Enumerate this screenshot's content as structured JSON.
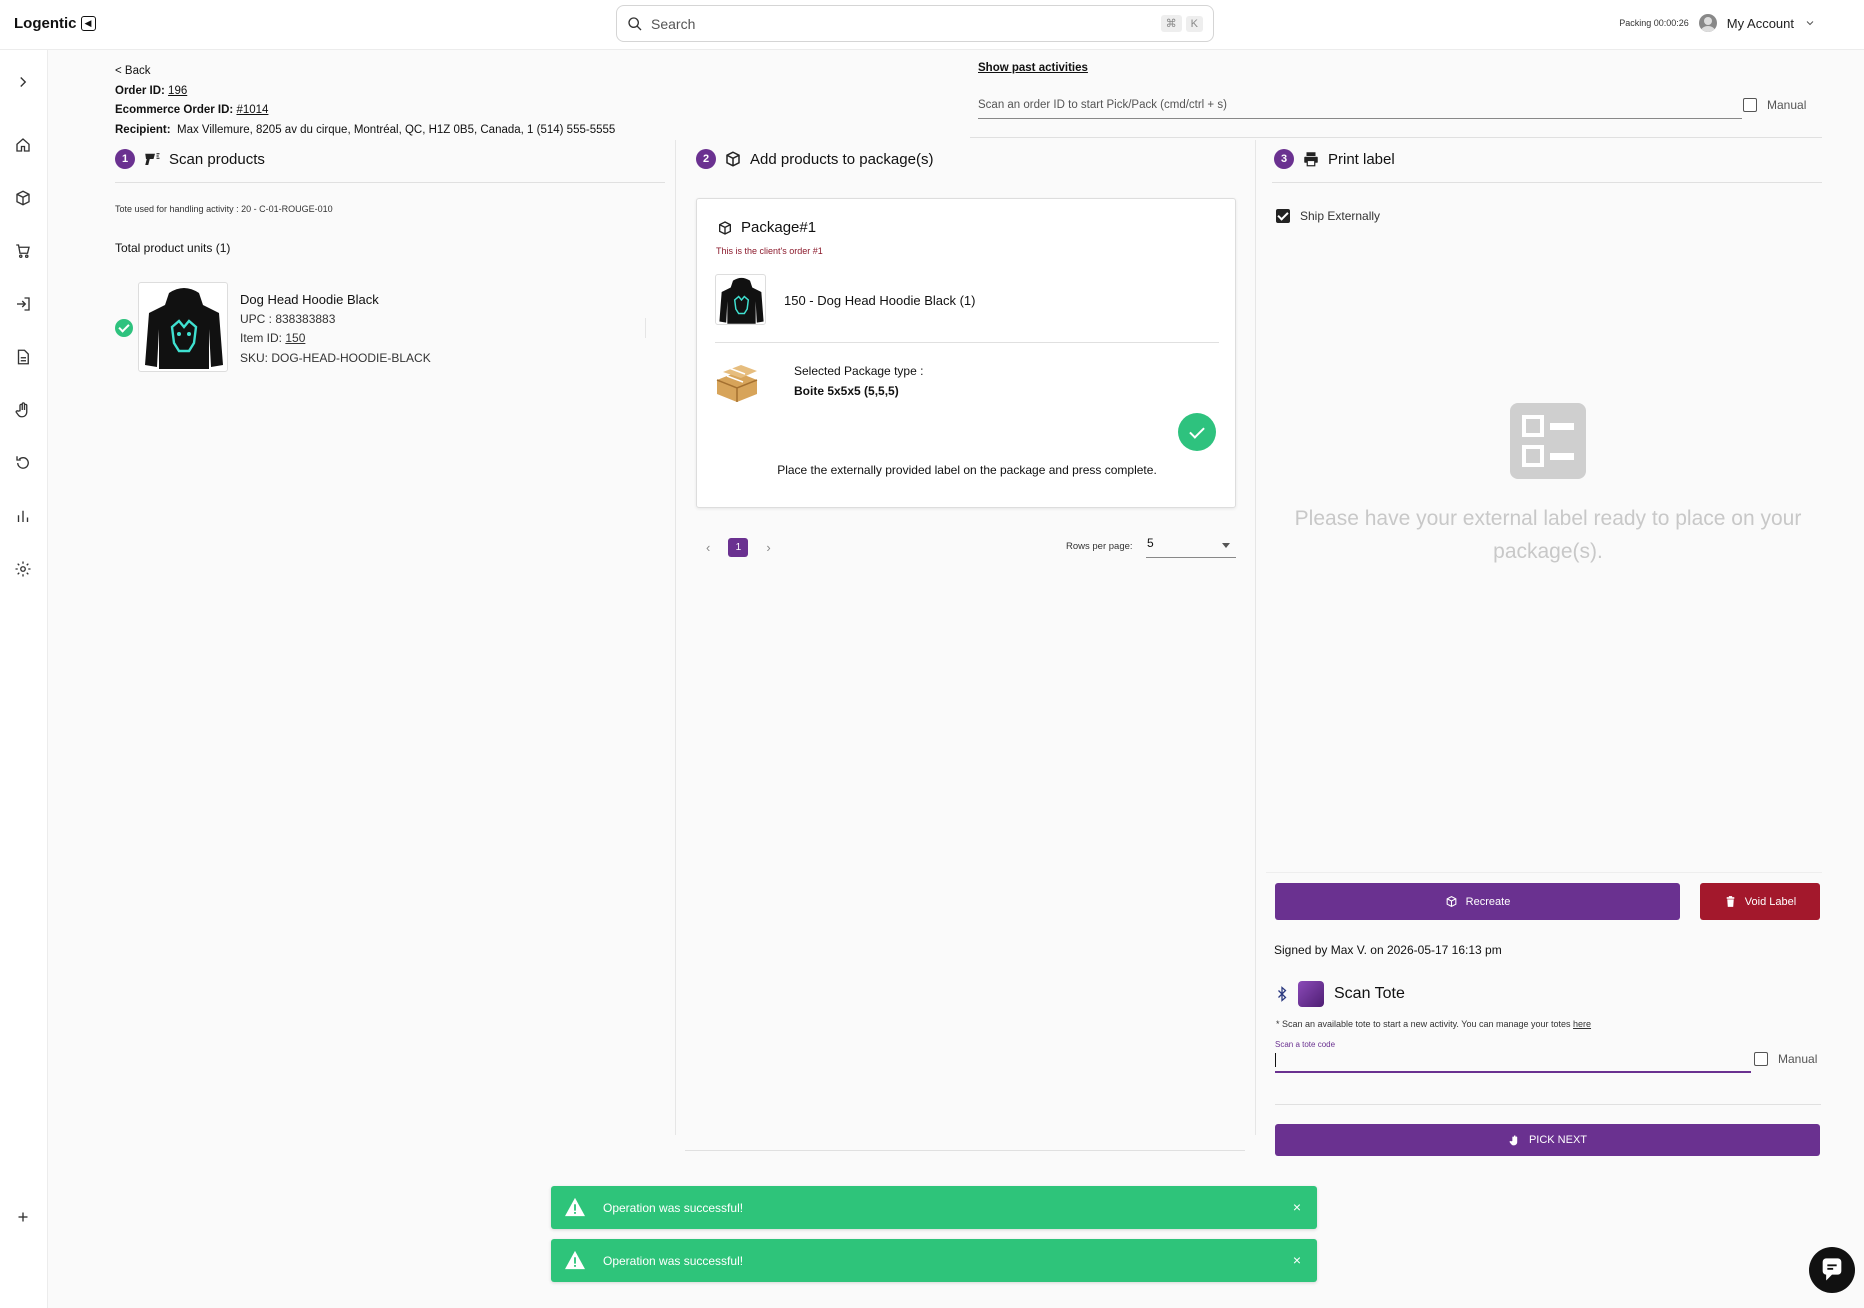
{
  "app": {
    "logo": "Logentic"
  },
  "search": {
    "placeholder": "Search",
    "kbd1": "⌘",
    "kbd2": "K"
  },
  "topbar": {
    "packing": "Packing 00:00:26",
    "account": "My Account"
  },
  "order": {
    "back": "< Back",
    "order_id_label": "Order ID:",
    "order_id": "196",
    "ecom_label": "Ecommerce Order ID:",
    "ecom_id": "#1014",
    "recipient_label": "Recipient:",
    "recipient": "Max Villemure, 8205 av du cirque, Montréal, QC, H1Z 0B5, Canada,  1 (514) 555-5555"
  },
  "activity": {
    "past_link": "Show past activities",
    "scan_placeholder": "Scan an order ID to start Pick/Pack (cmd/ctrl + s)",
    "manual": "Manual"
  },
  "steps": [
    {
      "num": "1",
      "title": "Scan products"
    },
    {
      "num": "2",
      "title": "Add products to package(s)"
    },
    {
      "num": "3",
      "title": "Print label"
    }
  ],
  "scan": {
    "tote_used": "Tote used for handling activity : 20 - C-01-ROUGE-010",
    "total_units": "Total product units (1)",
    "product": {
      "name": "Dog Head Hoodie Black",
      "upc": "UPC : 838383883",
      "item_label": "Item ID: ",
      "item_id": "150",
      "sku": "SKU: DOG-HEAD-HOODIE-BLACK"
    }
  },
  "package": {
    "title": "Package#1",
    "subtitle": "This is the client's order #1",
    "item": "150 - Dog Head Hoodie Black (1)",
    "type_label": "Selected Package type :",
    "type_value": "Boite 5x5x5 (5,5,5)",
    "note": "Place the externally provided label on the package and press complete.",
    "page": "1",
    "rows_label": "Rows per page:",
    "rows_value": "5"
  },
  "label": {
    "ship_externally": "Ship Externally",
    "placeholder_msg": "Please have your external label ready to place on your package(s).",
    "recreate": "Recreate",
    "void": "Void Label",
    "signed": "Signed by Max V. on 2026-05-17 16:13 pm"
  },
  "tote": {
    "title": "Scan Tote",
    "note_prefix": "* Scan an available tote to start a new activity. You can manage your totes ",
    "note_link": "here",
    "input_label": "Scan a tote code",
    "manual": "Manual",
    "pick_next": "PICK NEXT"
  },
  "toasts": [
    {
      "message": "Operation was successful!",
      "close": "×"
    },
    {
      "message": "Operation was successful!",
      "close": "×"
    }
  ],
  "colors": {
    "primary": "#6a3190",
    "danger": "#a3182c",
    "success": "#2ec47a"
  }
}
